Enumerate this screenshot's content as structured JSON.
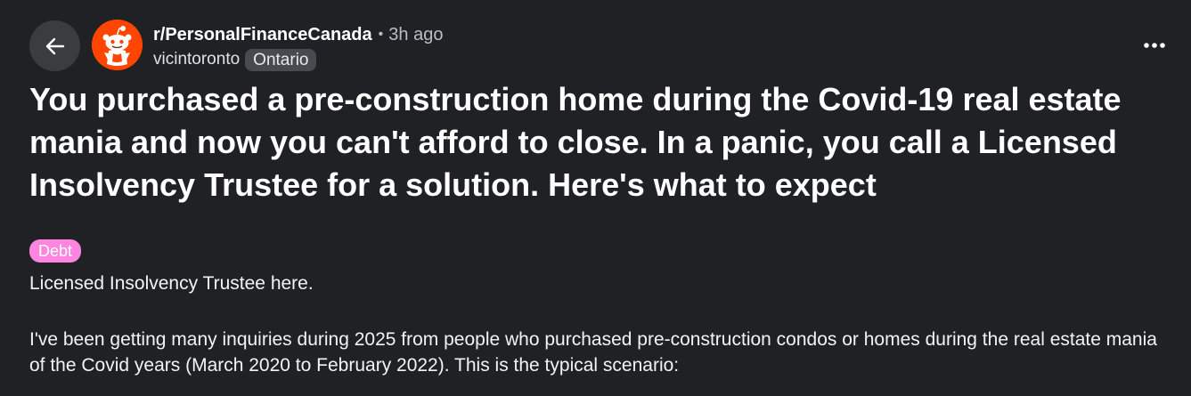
{
  "header": {
    "subreddit": "r/PersonalFinanceCanada",
    "separator": "•",
    "time_ago": "3h ago",
    "username": "vicintoronto",
    "user_flair": "Ontario"
  },
  "icons": {
    "back": "arrow-left-icon",
    "avatar": "reddit-snoo-icon",
    "more": "ellipsis-horizontal-icon"
  },
  "colors": {
    "background": "#1f2124",
    "avatar_bg": "#ff4500",
    "post_flair_bg": "#ff85e0",
    "user_flair_bg": "#474a4e"
  },
  "post": {
    "title": "You purchased a pre-construction home during the Covid-19 real estate mania and now you can't afford to close. In a panic, you call a Licensed Insolvency Trustee for a solution. Here's what to expect",
    "flair": "Debt",
    "body": [
      "Licensed Insolvency Trustee here.",
      "I've been getting many inquiries during 2025 from people who purchased pre-construction condos or homes during the real estate mania of the Covid years (March 2020 to February 2022). This is the typical scenario:"
    ]
  }
}
